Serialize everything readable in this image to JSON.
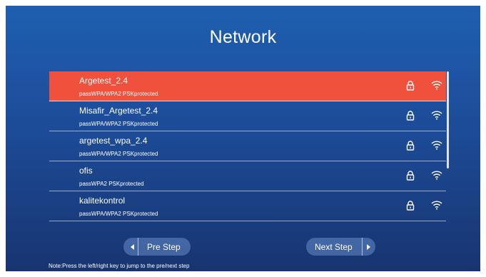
{
  "page": {
    "title": "Network"
  },
  "networks": [
    {
      "ssid": "Argetest_2.4",
      "security": "passWPA/WPA2 PSKprotected",
      "selected": true,
      "icons": [
        "lock-icon",
        "wifi-icon"
      ]
    },
    {
      "ssid": "Misafir_Argetest_2.4",
      "security": "passWPA/WPA2 PSKprotected",
      "selected": false,
      "icons": [
        "lock-icon",
        "wifi-icon"
      ]
    },
    {
      "ssid": "argetest_wpa_2.4",
      "security": "passWPA/WPA2 PSKprotected",
      "selected": false,
      "icons": [
        "lock-icon",
        "wifi-icon"
      ]
    },
    {
      "ssid": "ofis",
      "security": "passWPA2 PSKprotected",
      "selected": false,
      "icons": [
        "lock-icon",
        "wifi-icon"
      ]
    },
    {
      "ssid": "kalitekontrol",
      "security": "passWPA/WPA2 PSKprotected",
      "selected": false,
      "icons": [
        "lock-icon",
        "wifi-icon"
      ]
    }
  ],
  "buttons": {
    "pre": "Pre Step",
    "next": "Next Step"
  },
  "note": "Note:Press the left/right key to jump to the pre/next step",
  "colors": {
    "background": "#1d4e9c",
    "selected": "#f0513c",
    "text": "#ffffff"
  }
}
